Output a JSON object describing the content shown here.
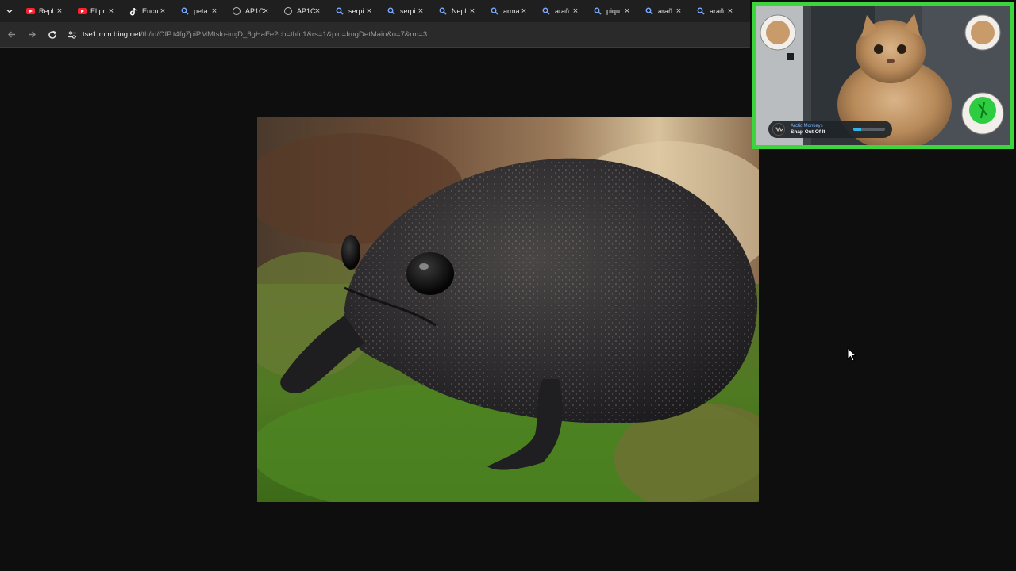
{
  "browser": {
    "tabs": [
      {
        "label": "Repl",
        "icon": "youtube-icon"
      },
      {
        "label": "El pri",
        "icon": "youtube-icon"
      },
      {
        "label": "Encu",
        "icon": "tiktok-icon"
      },
      {
        "label": "peta",
        "icon": "search-icon"
      },
      {
        "label": "AP1C",
        "icon": "globe-icon"
      },
      {
        "label": "AP1C",
        "icon": "globe-icon"
      },
      {
        "label": "serpi",
        "icon": "search-icon"
      },
      {
        "label": "serpi",
        "icon": "search-icon"
      },
      {
        "label": "Nepl",
        "icon": "search-icon"
      },
      {
        "label": "arma",
        "icon": "search-icon"
      },
      {
        "label": "arañ",
        "icon": "search-icon"
      },
      {
        "label": "piqu",
        "icon": "search-icon"
      },
      {
        "label": "arañ",
        "icon": "search-icon"
      },
      {
        "label": "arañ",
        "icon": "search-icon"
      }
    ],
    "close_glyph": "×",
    "url_host": "tse1.mm.bing.net",
    "url_path": "/th/id/OIP.t4fgZpiPMMtsln-imjD_6gHaFe?cb=thfc1&rs=1&pid=ImgDetMain&o=7&rm=3"
  },
  "overlay": {
    "now_playing": {
      "artist": "Arctic Monkeys",
      "song": "Snap Out Of It",
      "progress": 0.25
    },
    "frame_color": "#3cd63c"
  }
}
